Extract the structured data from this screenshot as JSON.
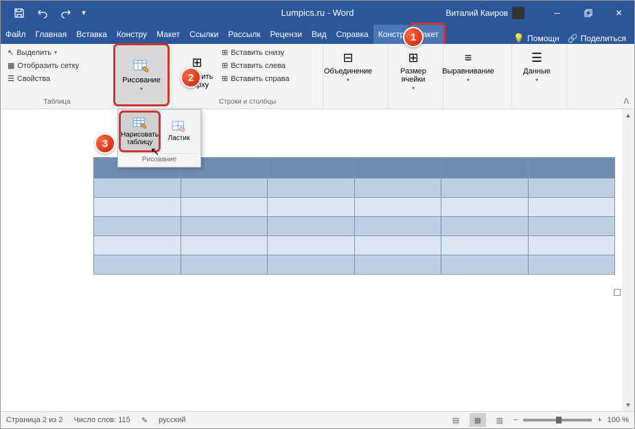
{
  "titlebar": {
    "title": "Lumpics.ru - Word",
    "user": "Виталий Каиров"
  },
  "tabs": {
    "items": [
      "Файл",
      "Главная",
      "Вставка",
      "Констру",
      "Макет",
      "Ссылки",
      "Рассылк",
      "Рецензи",
      "Вид",
      "Справка",
      "Констр",
      "Макет"
    ],
    "help": "Помощн",
    "share": "Поделиться"
  },
  "ribbon": {
    "table_group": {
      "label": "Таблица",
      "select": "Выделить",
      "grid": "Отобразить сетку",
      "props": "Свойства"
    },
    "drawing": {
      "label": "Рисование",
      "dd_label": "Рисование",
      "draw_table": "Нарисовать таблицу",
      "eraser": "Ластик"
    },
    "rows_cols": {
      "label": "Строки и столбцы",
      "insert_above": "Вставить сверху",
      "insert_below": "Вставить снизу",
      "insert_left": "Вставить слева",
      "insert_right": "Вставить справа"
    },
    "merge": {
      "label": "Объединение"
    },
    "cellsize": {
      "label": "Размер ячейки"
    },
    "align": {
      "label": "Выравнивание"
    },
    "data": {
      "label": "Данные"
    }
  },
  "callouts": {
    "c1": "1",
    "c2": "2",
    "c3": "3"
  },
  "statusbar": {
    "page": "Страница 2 из 2",
    "words": "Число слов: 115",
    "lang": "русский",
    "zoom": "100 %"
  }
}
